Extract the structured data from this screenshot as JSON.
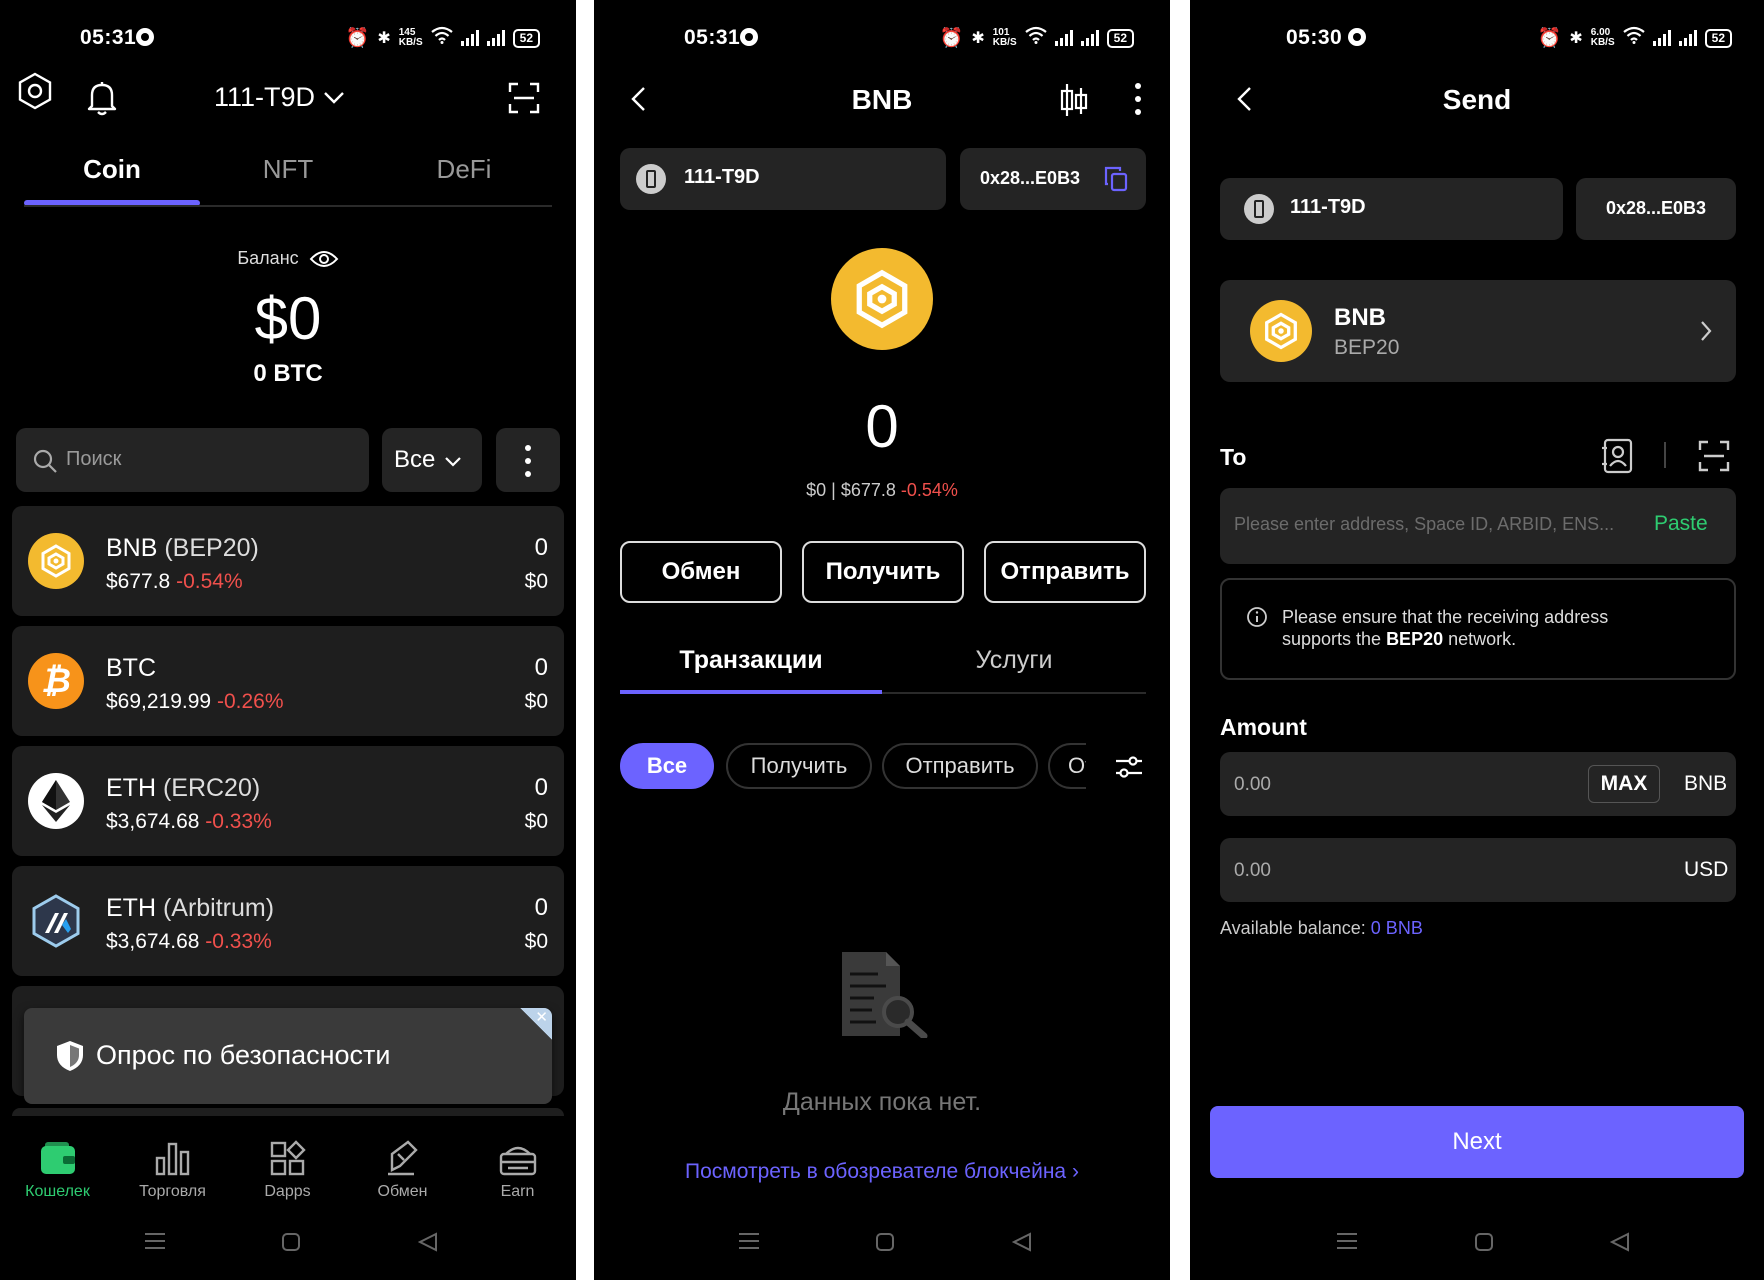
{
  "screens": [
    {
      "status": {
        "time": "05:31",
        "speed_top": "145",
        "speed_unit": "KB/S",
        "battery": "52"
      },
      "header": {
        "wallet_name": "111-T9D"
      },
      "tabs": [
        {
          "label": "Coin",
          "active": true
        },
        {
          "label": "NFT",
          "active": false
        },
        {
          "label": "DeFi",
          "active": false
        }
      ],
      "balance": {
        "label": "Баланс",
        "value": "$0",
        "btc": "0 BTC"
      },
      "search": {
        "placeholder": "Поиск",
        "filter": "Все"
      },
      "coins": [
        {
          "name": "BNB",
          "network": "(BEP20)",
          "price": "$677.8",
          "change": "-0.54%",
          "amount": "0",
          "usd": "$0",
          "icon": "bnb-logo",
          "color": "#F3BA2F"
        },
        {
          "name": "BTC",
          "network": "",
          "price": "$69,219.99",
          "change": "-0.26%",
          "amount": "0",
          "usd": "$0",
          "icon": "btc-logo",
          "color": "#F7931A"
        },
        {
          "name": "ETH",
          "network": "(ERC20)",
          "price": "$3,674.68",
          "change": "-0.33%",
          "amount": "0",
          "usd": "$0",
          "icon": "eth-logo",
          "color": "#ffffff"
        },
        {
          "name": "ETH",
          "network": "(Arbitrum)",
          "price": "$3,674.68",
          "change": "-0.33%",
          "amount": "0",
          "usd": "$0",
          "icon": "arbitrum-logo",
          "color": "#2D374B"
        }
      ],
      "survey_banner": "Опрос по безопасности",
      "bottom_nav": [
        {
          "label": "Кошелек",
          "icon": "wallet-icon",
          "active": true
        },
        {
          "label": "Торговля",
          "icon": "chart-bars-icon",
          "active": false
        },
        {
          "label": "Dapps",
          "icon": "grid-icon",
          "active": false
        },
        {
          "label": "Обмен",
          "icon": "swap-icon",
          "active": false
        },
        {
          "label": "Earn",
          "icon": "earn-icon",
          "active": false
        }
      ],
      "accent": "#6c63ff",
      "active_nav_color": "#2ecc71"
    },
    {
      "status": {
        "time": "05:31",
        "speed_top": "101",
        "speed_unit": "KB/S",
        "battery": "52"
      },
      "title": "BNB",
      "wallet": {
        "name": "111-T9D",
        "address": "0x28...E0B3"
      },
      "balance": {
        "amount": "0",
        "usd": "$0",
        "price": "$677.8",
        "separator": "|",
        "change": "-0.54%"
      },
      "actions": [
        {
          "label": "Обмен"
        },
        {
          "label": "Получить"
        },
        {
          "label": "Отправить"
        }
      ],
      "tabs": [
        {
          "label": "Транзакции",
          "active": true
        },
        {
          "label": "Услуги",
          "active": false
        }
      ],
      "filters": [
        {
          "label": "Все",
          "active": true
        },
        {
          "label": "Получить",
          "active": false
        },
        {
          "label": "Отправить",
          "active": false
        },
        {
          "label": "От",
          "active": false
        }
      ],
      "empty_text": "Данных пока нет.",
      "explorer_link": "Посмотреть в обозревателе блокчейна"
    },
    {
      "status": {
        "time": "05:30",
        "speed_top": "6.00",
        "speed_unit": "KB/S",
        "battery": "52"
      },
      "title": "Send",
      "wallet": {
        "name": "111-T9D",
        "address": "0x28...E0B3"
      },
      "token": {
        "name": "BNB",
        "network": "BEP20"
      },
      "to": {
        "label": "To",
        "placeholder": "Please enter address, Space ID, ARBID, ENS...",
        "paste": "Paste"
      },
      "notice": {
        "prefix": "Please ensure that the receiving address supports the ",
        "bold": "BEP20",
        "suffix": " network."
      },
      "amount": {
        "label": "Amount",
        "placeholder": "0.00",
        "max": "MAX",
        "unit": "BNB",
        "usd_placeholder": "0.00",
        "usd_unit": "USD"
      },
      "available": {
        "label": "Available balance:",
        "value": "0 BNB"
      },
      "next_button": "Next",
      "paste_color": "#2ecc71",
      "link_color": "#6c63ff"
    }
  ]
}
